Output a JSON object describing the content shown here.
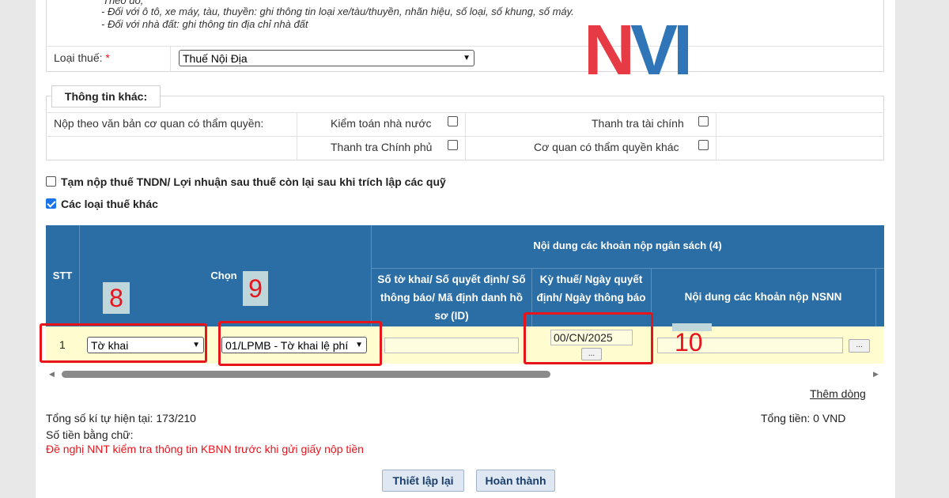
{
  "notes": {
    "line0": "Theo đó,",
    "line1": "- Đối với ô tô, xe máy, tàu, thuyền: ghi thông tin loại xe/tàu/thuyền, nhãn hiệu, số loại, số khung, số máy.",
    "line2": "- Đối với nhà đất: ghi thông tin địa chỉ nhà đất"
  },
  "loai_thue": {
    "label": "Loại thuế:",
    "required_mark": "*",
    "selected": "Thuế Nội Địa"
  },
  "logo": {
    "text_n": "N",
    "text_v": "V",
    "text_i": "I",
    "color_n": "#e63a44",
    "color_v": "#2f75b7",
    "color_i": "#2f75b7"
  },
  "thong_tin_khac": {
    "title": "Thông tin khác:",
    "nop_theo_label": "Nộp theo văn bản cơ quan có thẩm quyền:",
    "options": [
      {
        "label": "Kiểm toán nhà nước",
        "checked": false
      },
      {
        "label": "Thanh tra tài chính",
        "checked": false
      },
      {
        "label": "Thanh tra Chính phủ",
        "checked": false
      },
      {
        "label": "Cơ quan có thẩm quyền khác",
        "checked": false
      }
    ]
  },
  "checkboxes": {
    "tam_nop": {
      "label": "Tạm nộp thuế TNDN/ Lợi nhuận sau thuế còn lại sau khi trích lập các quỹ",
      "checked": false
    },
    "cac_loai": {
      "label": "Các loại thuế khác",
      "checked": true
    }
  },
  "table": {
    "header_stt": "STT",
    "header_chon": "Chọn",
    "header_group": "Nội dung các khoản nộp ngân sách (4)",
    "header_so_to_khai": "Số tờ khai/ Số quyết định/ Số thông báo/ Mã định danh hồ sơ (ID)",
    "header_ky_thue": "Kỳ thuế/ Ngày quyết định/ Ngày thông báo",
    "header_noi_dung": "Nội dung các khoản nộp NSNN",
    "row": {
      "stt": "1",
      "loai": "Tờ khai",
      "to_khai": "01/LPMB - Tờ khai lệ phí",
      "so_to_khai": "",
      "ky_thue": "00/CN/2025",
      "noi_dung": "",
      "ellipsis": "..."
    }
  },
  "annotations": {
    "n8": "8",
    "n9": "9",
    "n10": "10"
  },
  "them_dong": "Thêm dòng",
  "tong_ky_tu": "Tổng số kí tự hiện tại: 173/210",
  "tong_tien": "Tổng tiền: 0 VND",
  "so_tien_chu": "Số tiền bằng chữ:",
  "warning": "Đề nghị NNT kiểm tra thông tin KBNN trước khi gửi giấy nộp tiền",
  "buttons": {
    "reset": "Thiết lập lại",
    "done": "Hoàn thành"
  }
}
